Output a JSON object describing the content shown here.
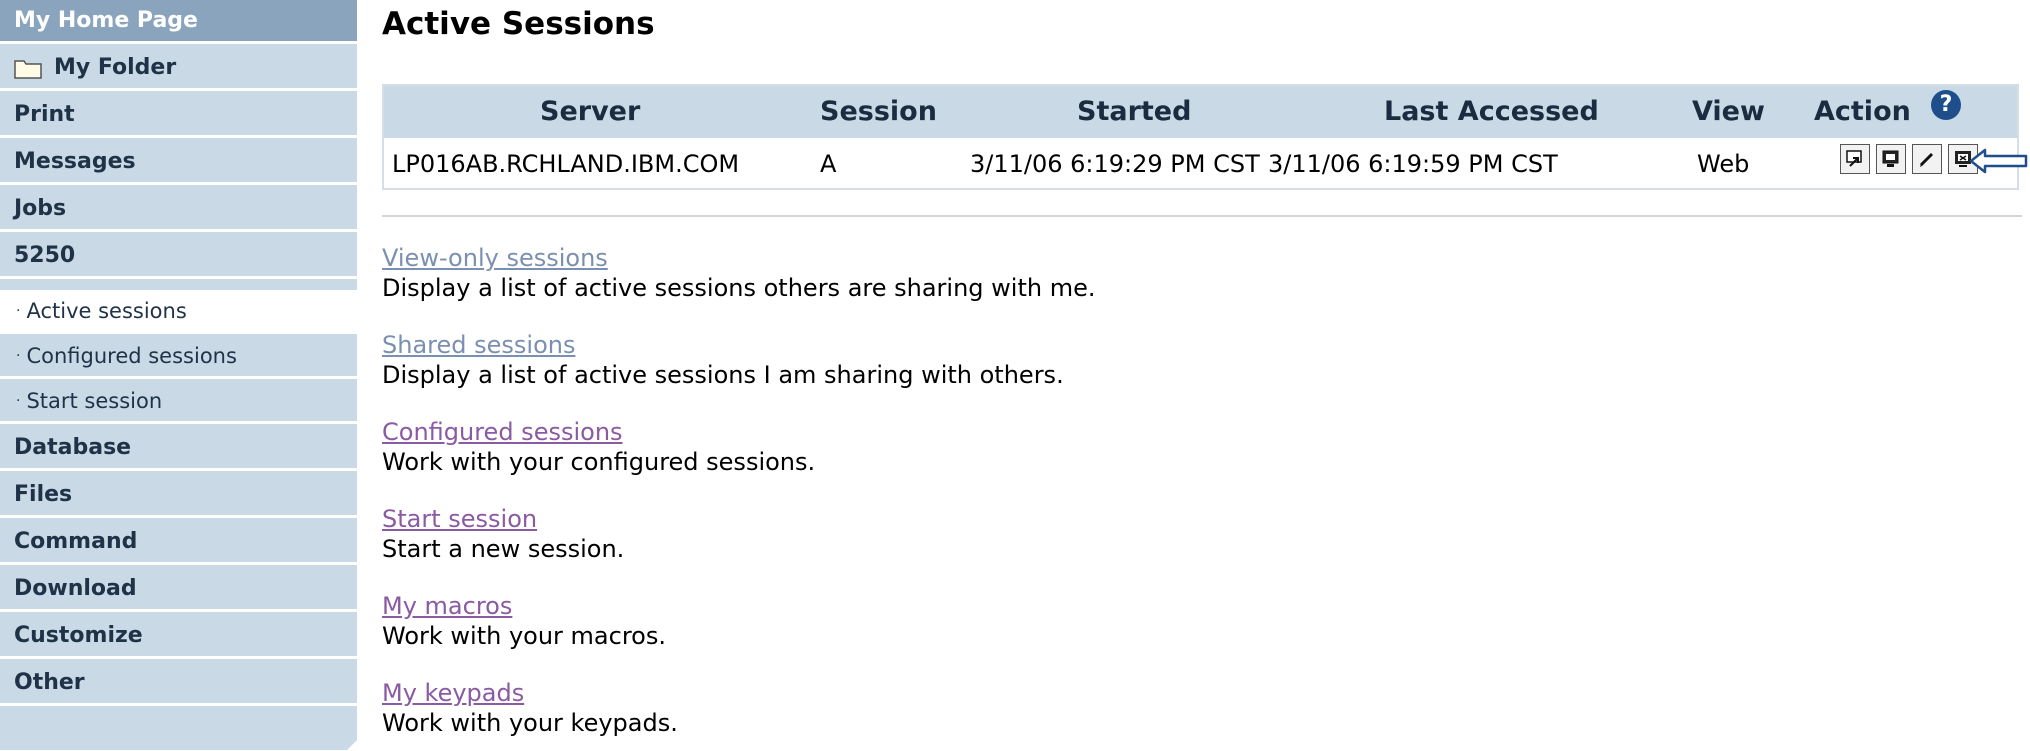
{
  "sidebar": {
    "home": "My Home Page",
    "folder": "My Folder",
    "items": [
      {
        "label": "Print"
      },
      {
        "label": "Messages"
      },
      {
        "label": "Jobs"
      },
      {
        "label": "5250"
      }
    ],
    "sub_items": [
      {
        "label": "Active sessions",
        "active": true
      },
      {
        "label": "Configured sessions",
        "active": false
      },
      {
        "label": "Start session",
        "active": false
      }
    ],
    "items_after": [
      {
        "label": "Database"
      },
      {
        "label": "Files"
      },
      {
        "label": "Command"
      },
      {
        "label": "Download"
      },
      {
        "label": "Customize"
      },
      {
        "label": "Other"
      }
    ],
    "bullet": "·"
  },
  "main": {
    "title": "Active Sessions",
    "table": {
      "headers": {
        "server": "Server",
        "session": "Session",
        "started": "Started",
        "last_accessed": "Last Accessed",
        "view": "View",
        "action": "Action"
      },
      "help_glyph": "?",
      "rows": [
        {
          "server": "LP016AB.RCHLAND.IBM.COM",
          "session": "A",
          "started": "3/11/06 6:19:29 PM CST",
          "last_accessed": "3/11/06 6:19:59 PM CST",
          "view": "Web"
        }
      ],
      "action_icons": [
        "open-session-icon",
        "share-session-icon",
        "edit-session-icon",
        "stop-session-icon"
      ]
    },
    "links": [
      {
        "label": "View-only sessions",
        "desc": "Display a list of active sessions others are sharing with me."
      },
      {
        "label": "Shared sessions",
        "desc": "Display a list of active sessions I am sharing with others."
      },
      {
        "label": "Configured sessions",
        "desc": "Work with your configured sessions."
      },
      {
        "label": "Start session",
        "desc": "Start a new session."
      },
      {
        "label": "My macros",
        "desc": "Work with your macros."
      },
      {
        "label": "My keypads",
        "desc": "Work with your keypads."
      }
    ]
  },
  "colors": {
    "sidebar_bg": "#c9d9e6",
    "home_bg": "#8aa4bd",
    "link_visited": "#8a5aa3",
    "link_blue": "#7b8fb0"
  }
}
